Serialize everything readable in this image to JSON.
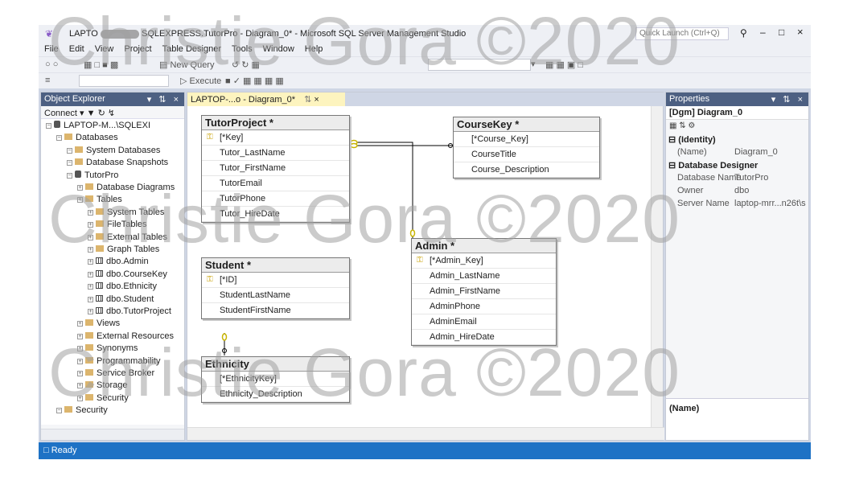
{
  "window": {
    "title_prefix": "LAPTO",
    "title_suffix": "SQLEXPRESS.TutorPro - Diagram_0* - Microsoft SQL Server Management Studio",
    "quick_launch": "Quick Launch (Ctrl+Q)",
    "controls": [
      "–",
      "□",
      "×"
    ]
  },
  "menu": [
    "File",
    "Edit",
    "View",
    "Project",
    "Table Designer",
    "Tools",
    "Window",
    "Help"
  ],
  "toolbar": {
    "new_query": "New Query",
    "execute": "Execute"
  },
  "object_explorer": {
    "title": "Object Explorer",
    "connect": "Connect",
    "items": [
      {
        "label": "LAPTOP-M...\\SQLEXI",
        "level": 0,
        "icon": "server"
      },
      {
        "label": "Databases",
        "level": 1,
        "icon": "folder"
      },
      {
        "label": "System Databases",
        "level": 2,
        "icon": "folder"
      },
      {
        "label": "Database Snapshots",
        "level": 2,
        "icon": "folder"
      },
      {
        "label": "TutorPro",
        "level": 2,
        "icon": "database"
      },
      {
        "label": "Database Diagrams",
        "level": 3,
        "icon": "folder"
      },
      {
        "label": "Tables",
        "level": 3,
        "icon": "folder"
      },
      {
        "label": "System Tables",
        "level": 4,
        "icon": "folder"
      },
      {
        "label": "FileTables",
        "level": 4,
        "icon": "folder"
      },
      {
        "label": "External Tables",
        "level": 4,
        "icon": "folder"
      },
      {
        "label": "Graph Tables",
        "level": 4,
        "icon": "folder"
      },
      {
        "label": "dbo.Admin",
        "level": 4,
        "icon": "table"
      },
      {
        "label": "dbo.CourseKey",
        "level": 4,
        "icon": "table"
      },
      {
        "label": "dbo.Ethnicity",
        "level": 4,
        "icon": "table"
      },
      {
        "label": "dbo.Student",
        "level": 4,
        "icon": "table"
      },
      {
        "label": "dbo.TutorProject",
        "level": 4,
        "icon": "table"
      },
      {
        "label": "Views",
        "level": 3,
        "icon": "folder"
      },
      {
        "label": "External Resources",
        "level": 3,
        "icon": "folder"
      },
      {
        "label": "Synonyms",
        "level": 3,
        "icon": "folder"
      },
      {
        "label": "Programmability",
        "level": 3,
        "icon": "folder"
      },
      {
        "label": "Service Broker",
        "level": 3,
        "icon": "folder"
      },
      {
        "label": "Storage",
        "level": 3,
        "icon": "folder"
      },
      {
        "label": "Security",
        "level": 3,
        "icon": "folder"
      },
      {
        "label": "Security",
        "level": 1,
        "icon": "folder"
      }
    ]
  },
  "document": {
    "tab_label": "LAPTOP-...o - Diagram_0*",
    "entities": [
      {
        "name": "TutorProject *",
        "rows": [
          {
            "text": "[*Key]",
            "key": true
          },
          {
            "text": "Tutor_LastName"
          },
          {
            "text": "Tutor_FirstName"
          },
          {
            "text": "TutorEmail"
          },
          {
            "text": "TutorPhone"
          },
          {
            "text": "Tutor_HireDate"
          }
        ]
      },
      {
        "name": "CourseKey *",
        "rows": [
          {
            "text": "[*Course_Key]"
          },
          {
            "text": "CourseTitle"
          },
          {
            "text": "Course_Description"
          }
        ]
      },
      {
        "name": "Student *",
        "rows": [
          {
            "text": "[*ID]",
            "key": true
          },
          {
            "text": "StudentLastName"
          },
          {
            "text": "StudentFirstName"
          }
        ]
      },
      {
        "name": "Admin *",
        "rows": [
          {
            "text": "[*Admin_Key]",
            "key": true
          },
          {
            "text": "Admin_LastName"
          },
          {
            "text": "Admin_FirstName"
          },
          {
            "text": "AdminPhone"
          },
          {
            "text": "AdminEmail"
          },
          {
            "text": "Admin_HireDate"
          }
        ]
      },
      {
        "name": "Ethnicity",
        "rows": [
          {
            "text": "[*EthnicityKey]"
          },
          {
            "text": "Ethnicity_Description"
          }
        ]
      }
    ]
  },
  "properties": {
    "title": "Properties",
    "object": "[Dgm] Diagram_0",
    "sections": [
      {
        "name": "(Identity)",
        "rows": [
          {
            "k": "(Name)",
            "v": "Diagram_0"
          }
        ]
      },
      {
        "name": "Database Designer",
        "rows": [
          {
            "k": "Database Name",
            "v": "TutorPro"
          },
          {
            "k": "Owner",
            "v": "dbo"
          },
          {
            "k": "Server Name",
            "v": "laptop-mrr...n26t\\s"
          }
        ]
      }
    ],
    "footer": "(Name)"
  },
  "status": {
    "text": "Ready"
  },
  "watermark": "Christie Gora ©2020",
  "colors": {
    "accent": "#4d6082",
    "status": "#1e72c5",
    "tab": "#fdf4bf",
    "relationship": "#c8b400"
  }
}
